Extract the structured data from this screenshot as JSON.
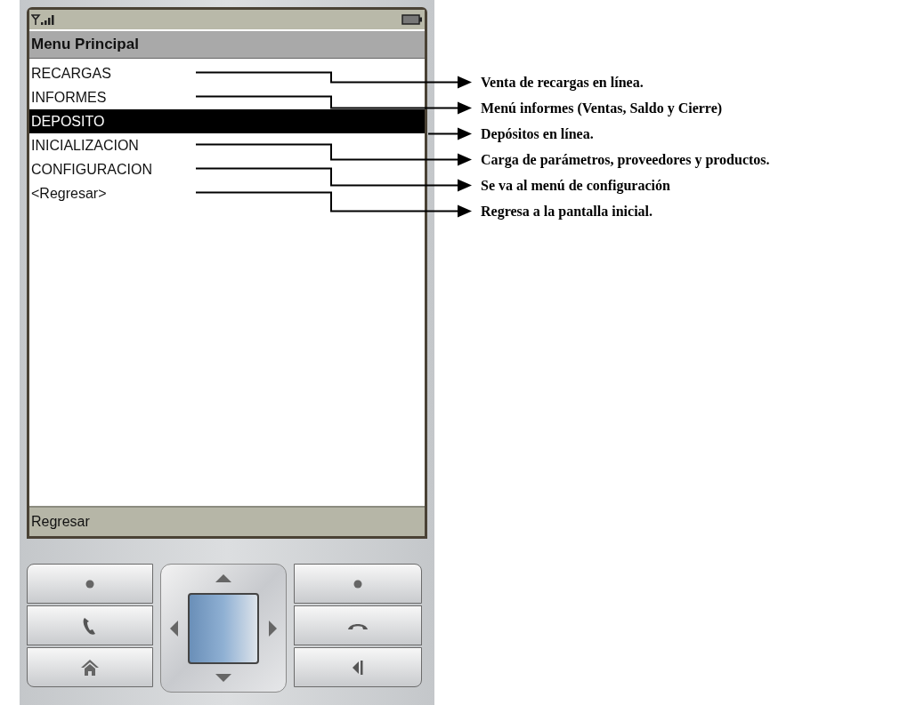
{
  "screen": {
    "title": "Menu Principal",
    "menu_items": [
      {
        "label": "RECARGAS",
        "selected": false
      },
      {
        "label": "INFORMES",
        "selected": false
      },
      {
        "label": "DEPOSITO",
        "selected": true
      },
      {
        "label": "INICIALIZACION",
        "selected": false
      },
      {
        "label": "CONFIGURACION",
        "selected": false
      },
      {
        "label": "<Regresar>",
        "selected": false
      }
    ],
    "softkey": "Regresar"
  },
  "annotations": [
    "Venta de recargas en línea.",
    "Menú informes (Ventas, Saldo y Cierre)",
    "Depósitos en línea.",
    "Carga de parámetros, proveedores y productos.",
    "Se va al menú de configuración",
    "Regresa  a la pantalla inicial."
  ]
}
